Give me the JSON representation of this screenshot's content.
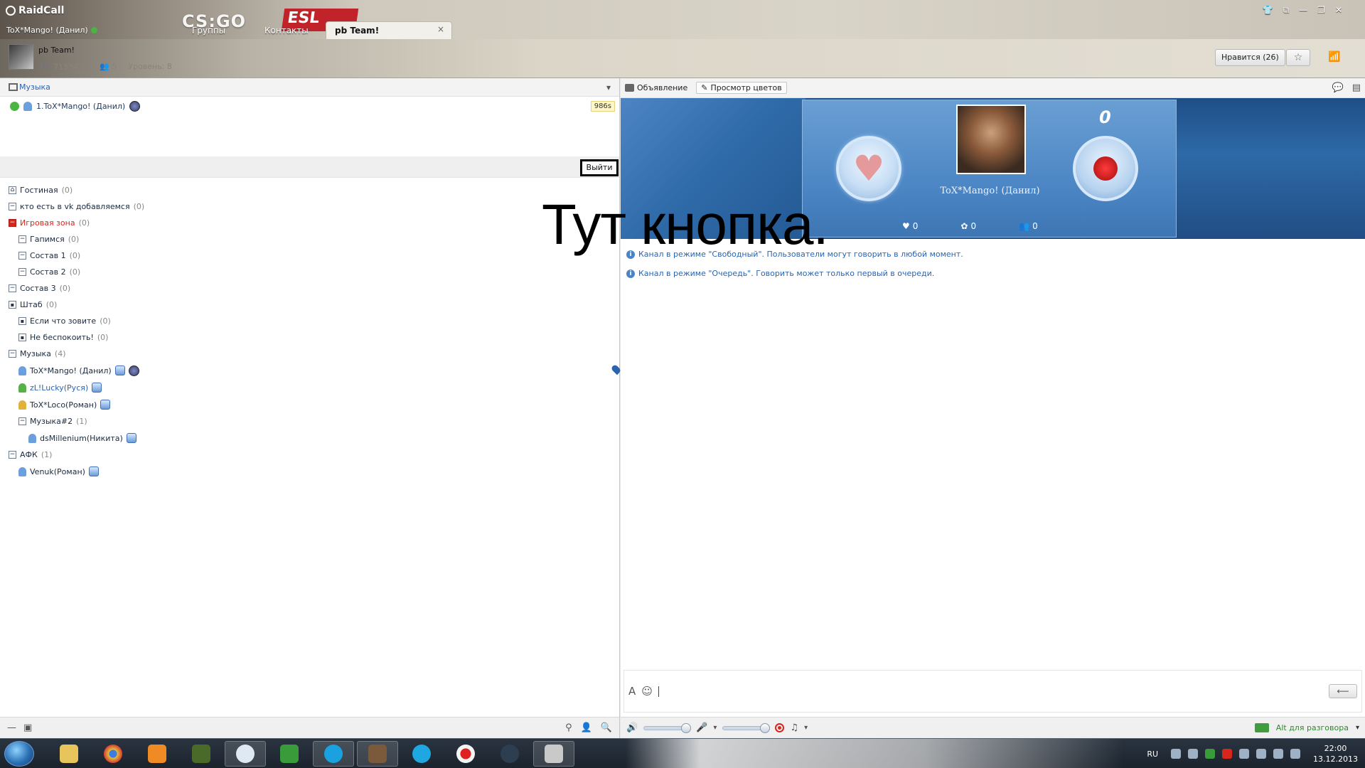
{
  "header": {
    "app_name": "RaidCall",
    "user": "ToX*Mango! (Данил)",
    "nav": [
      "Группы",
      "Контакты"
    ],
    "active_tab": "pb Team!",
    "tab_close": "×",
    "banner_csgo": "CS:GO",
    "banner_esl": "ESL",
    "window_controls": [
      "👕",
      "⧉",
      "—",
      "❐",
      "✕"
    ]
  },
  "channel": {
    "name": "pb Team!",
    "id_label": "ID",
    "id": "7153430",
    "members": "5",
    "level": "Уровень: 8",
    "like_button": "Нравится (26)",
    "star": "☆",
    "signal": "📶"
  },
  "left": {
    "section_title": "Музыка",
    "more_icon": "▾",
    "queue": [
      {
        "label": "1.ToX*Mango! (Данил)"
      }
    ],
    "timer": "986s",
    "exit_button": "Выйти",
    "tree": [
      {
        "label": "Гостиная",
        "count": "(0)"
      },
      {
        "label": "кто есть в vk добавляемся",
        "count": "(0)"
      },
      {
        "label": "Игровая зона",
        "count": "(0)"
      },
      {
        "label": "Гапимся",
        "count": "(0)"
      },
      {
        "label": "Состав 1",
        "count": "(0)"
      },
      {
        "label": "Состав 2",
        "count": "(0)"
      },
      {
        "label": "Состав 3",
        "count": "(0)"
      },
      {
        "label": "Штаб",
        "count": "(0)"
      },
      {
        "label": "Если что зовите",
        "count": "(0)"
      },
      {
        "label": "Не беспокоить!",
        "count": "(0)"
      },
      {
        "label": "Музыка",
        "count": "(4)"
      },
      {
        "label": "Музыка#2",
        "count": "(1)"
      },
      {
        "label": "АФК",
        "count": "(1)"
      }
    ],
    "users": [
      "ToX*Mango! (Данил)",
      "zL!Lucky(Руся)",
      "ToX*Loco(Роман)",
      "dsMillenium(Никита)",
      "Venuk(Роман)"
    ],
    "footer_icons": [
      "—",
      "▣",
      "⚲",
      "👤",
      "🔍"
    ]
  },
  "right": {
    "toolbar": {
      "announcement": "Объявление",
      "view_colors": "Просмотр цветов"
    },
    "toolbar_icons": [
      "💬",
      "▤"
    ],
    "profile": {
      "name": "ToX*Mango! (Данил)",
      "rose_count": "0",
      "likes": "0",
      "flowers": "0",
      "fans": "0",
      "heart": "♥",
      "like_icon": "♥",
      "flower_icon": "✿",
      "fans_icon": "👥"
    },
    "messages": [
      "Канал в режиме \"Свободный\". Пользователи могут говорить в любой момент.",
      "Канал в режиме \"Очередь\". Говорить может только первый в очереди."
    ],
    "input": {
      "font_tool": "A",
      "emoji_tool": "☺",
      "send": "⟵"
    },
    "footer": {
      "speaker": "🔊",
      "mic_icon": "🎤",
      "music_icon": "♫",
      "dropdown": "▾",
      "push_to_talk": "Alt для разговора"
    }
  },
  "annotation": "Тут кнопка.",
  "taskbar": {
    "apps": [
      "folder",
      "chrome",
      "media",
      "emis",
      "raidcall",
      "game",
      "skype",
      "avatar",
      "z-app",
      "rec",
      "steam",
      "xfire"
    ],
    "lang": "RU",
    "time": "22:00",
    "date": "13.12.2013"
  },
  "colors": {
    "accent_blue": "#2a64b0",
    "red_channel": "#d9261c",
    "online_green": "#4bb543",
    "banner_blue": "#2d6aa8"
  }
}
